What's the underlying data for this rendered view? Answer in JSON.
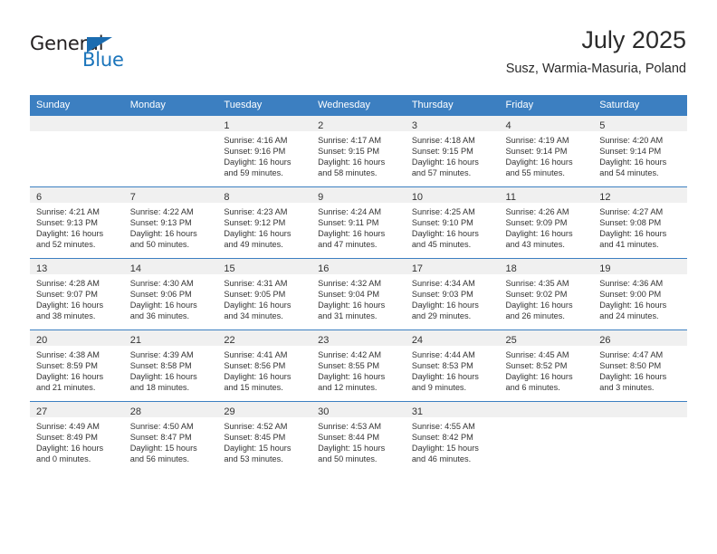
{
  "brand": {
    "name_part1": "General",
    "name_part2": "Blue",
    "triangle_color": "#1b6cb0",
    "blue_color": "#1b75bb"
  },
  "header": {
    "title": "July 2025",
    "subtitle": "Susz, Warmia-Masuria, Poland"
  },
  "theme": {
    "header_bg": "#3c7fc1",
    "daynum_bg": "#f0f0f0",
    "row_divider": "#3c7fc1",
    "text": "#333333"
  },
  "weekdays": [
    "Sunday",
    "Monday",
    "Tuesday",
    "Wednesday",
    "Thursday",
    "Friday",
    "Saturday"
  ],
  "weeks": [
    [
      {
        "day": "",
        "l1": "",
        "l2": "",
        "l3": "",
        "l4": ""
      },
      {
        "day": "",
        "l1": "",
        "l2": "",
        "l3": "",
        "l4": ""
      },
      {
        "day": "1",
        "l1": "Sunrise: 4:16 AM",
        "l2": "Sunset: 9:16 PM",
        "l3": "Daylight: 16 hours",
        "l4": "and 59 minutes."
      },
      {
        "day": "2",
        "l1": "Sunrise: 4:17 AM",
        "l2": "Sunset: 9:15 PM",
        "l3": "Daylight: 16 hours",
        "l4": "and 58 minutes."
      },
      {
        "day": "3",
        "l1": "Sunrise: 4:18 AM",
        "l2": "Sunset: 9:15 PM",
        "l3": "Daylight: 16 hours",
        "l4": "and 57 minutes."
      },
      {
        "day": "4",
        "l1": "Sunrise: 4:19 AM",
        "l2": "Sunset: 9:14 PM",
        "l3": "Daylight: 16 hours",
        "l4": "and 55 minutes."
      },
      {
        "day": "5",
        "l1": "Sunrise: 4:20 AM",
        "l2": "Sunset: 9:14 PM",
        "l3": "Daylight: 16 hours",
        "l4": "and 54 minutes."
      }
    ],
    [
      {
        "day": "6",
        "l1": "Sunrise: 4:21 AM",
        "l2": "Sunset: 9:13 PM",
        "l3": "Daylight: 16 hours",
        "l4": "and 52 minutes."
      },
      {
        "day": "7",
        "l1": "Sunrise: 4:22 AM",
        "l2": "Sunset: 9:13 PM",
        "l3": "Daylight: 16 hours",
        "l4": "and 50 minutes."
      },
      {
        "day": "8",
        "l1": "Sunrise: 4:23 AM",
        "l2": "Sunset: 9:12 PM",
        "l3": "Daylight: 16 hours",
        "l4": "and 49 minutes."
      },
      {
        "day": "9",
        "l1": "Sunrise: 4:24 AM",
        "l2": "Sunset: 9:11 PM",
        "l3": "Daylight: 16 hours",
        "l4": "and 47 minutes."
      },
      {
        "day": "10",
        "l1": "Sunrise: 4:25 AM",
        "l2": "Sunset: 9:10 PM",
        "l3": "Daylight: 16 hours",
        "l4": "and 45 minutes."
      },
      {
        "day": "11",
        "l1": "Sunrise: 4:26 AM",
        "l2": "Sunset: 9:09 PM",
        "l3": "Daylight: 16 hours",
        "l4": "and 43 minutes."
      },
      {
        "day": "12",
        "l1": "Sunrise: 4:27 AM",
        "l2": "Sunset: 9:08 PM",
        "l3": "Daylight: 16 hours",
        "l4": "and 41 minutes."
      }
    ],
    [
      {
        "day": "13",
        "l1": "Sunrise: 4:28 AM",
        "l2": "Sunset: 9:07 PM",
        "l3": "Daylight: 16 hours",
        "l4": "and 38 minutes."
      },
      {
        "day": "14",
        "l1": "Sunrise: 4:30 AM",
        "l2": "Sunset: 9:06 PM",
        "l3": "Daylight: 16 hours",
        "l4": "and 36 minutes."
      },
      {
        "day": "15",
        "l1": "Sunrise: 4:31 AM",
        "l2": "Sunset: 9:05 PM",
        "l3": "Daylight: 16 hours",
        "l4": "and 34 minutes."
      },
      {
        "day": "16",
        "l1": "Sunrise: 4:32 AM",
        "l2": "Sunset: 9:04 PM",
        "l3": "Daylight: 16 hours",
        "l4": "and 31 minutes."
      },
      {
        "day": "17",
        "l1": "Sunrise: 4:34 AM",
        "l2": "Sunset: 9:03 PM",
        "l3": "Daylight: 16 hours",
        "l4": "and 29 minutes."
      },
      {
        "day": "18",
        "l1": "Sunrise: 4:35 AM",
        "l2": "Sunset: 9:02 PM",
        "l3": "Daylight: 16 hours",
        "l4": "and 26 minutes."
      },
      {
        "day": "19",
        "l1": "Sunrise: 4:36 AM",
        "l2": "Sunset: 9:00 PM",
        "l3": "Daylight: 16 hours",
        "l4": "and 24 minutes."
      }
    ],
    [
      {
        "day": "20",
        "l1": "Sunrise: 4:38 AM",
        "l2": "Sunset: 8:59 PM",
        "l3": "Daylight: 16 hours",
        "l4": "and 21 minutes."
      },
      {
        "day": "21",
        "l1": "Sunrise: 4:39 AM",
        "l2": "Sunset: 8:58 PM",
        "l3": "Daylight: 16 hours",
        "l4": "and 18 minutes."
      },
      {
        "day": "22",
        "l1": "Sunrise: 4:41 AM",
        "l2": "Sunset: 8:56 PM",
        "l3": "Daylight: 16 hours",
        "l4": "and 15 minutes."
      },
      {
        "day": "23",
        "l1": "Sunrise: 4:42 AM",
        "l2": "Sunset: 8:55 PM",
        "l3": "Daylight: 16 hours",
        "l4": "and 12 minutes."
      },
      {
        "day": "24",
        "l1": "Sunrise: 4:44 AM",
        "l2": "Sunset: 8:53 PM",
        "l3": "Daylight: 16 hours",
        "l4": "and 9 minutes."
      },
      {
        "day": "25",
        "l1": "Sunrise: 4:45 AM",
        "l2": "Sunset: 8:52 PM",
        "l3": "Daylight: 16 hours",
        "l4": "and 6 minutes."
      },
      {
        "day": "26",
        "l1": "Sunrise: 4:47 AM",
        "l2": "Sunset: 8:50 PM",
        "l3": "Daylight: 16 hours",
        "l4": "and 3 minutes."
      }
    ],
    [
      {
        "day": "27",
        "l1": "Sunrise: 4:49 AM",
        "l2": "Sunset: 8:49 PM",
        "l3": "Daylight: 16 hours",
        "l4": "and 0 minutes."
      },
      {
        "day": "28",
        "l1": "Sunrise: 4:50 AM",
        "l2": "Sunset: 8:47 PM",
        "l3": "Daylight: 15 hours",
        "l4": "and 56 minutes."
      },
      {
        "day": "29",
        "l1": "Sunrise: 4:52 AM",
        "l2": "Sunset: 8:45 PM",
        "l3": "Daylight: 15 hours",
        "l4": "and 53 minutes."
      },
      {
        "day": "30",
        "l1": "Sunrise: 4:53 AM",
        "l2": "Sunset: 8:44 PM",
        "l3": "Daylight: 15 hours",
        "l4": "and 50 minutes."
      },
      {
        "day": "31",
        "l1": "Sunrise: 4:55 AM",
        "l2": "Sunset: 8:42 PM",
        "l3": "Daylight: 15 hours",
        "l4": "and 46 minutes."
      },
      {
        "day": "",
        "l1": "",
        "l2": "",
        "l3": "",
        "l4": ""
      },
      {
        "day": "",
        "l1": "",
        "l2": "",
        "l3": "",
        "l4": ""
      }
    ]
  ]
}
